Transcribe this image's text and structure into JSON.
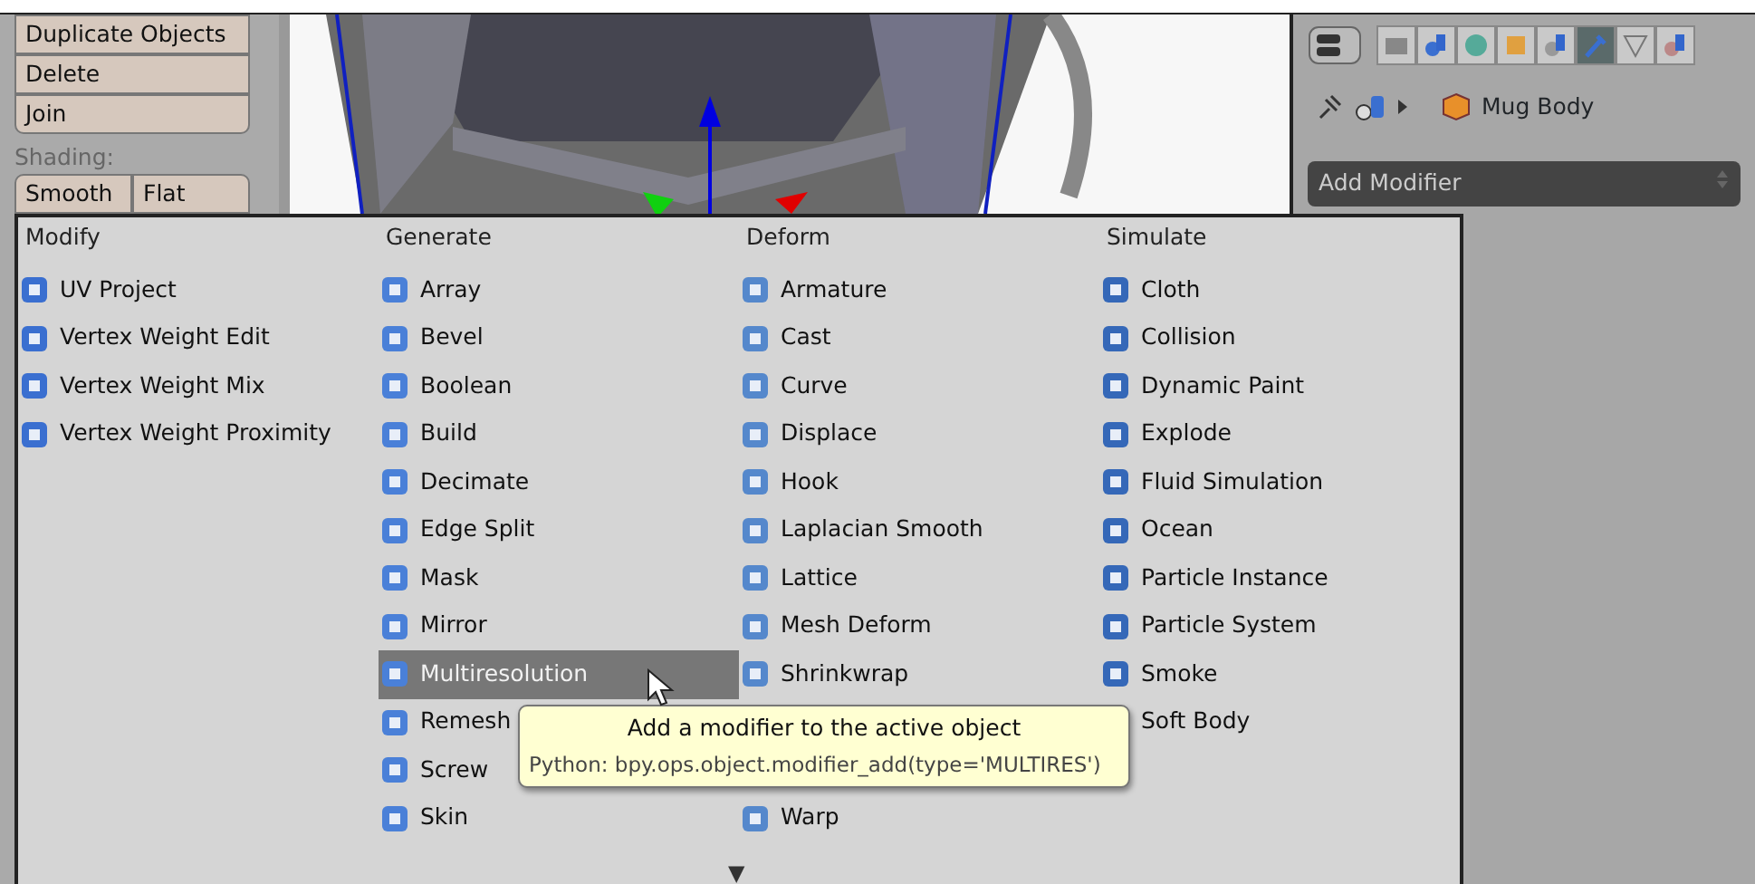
{
  "tool_panel": {
    "buttons": [
      "Duplicate Objects",
      "Delete",
      "Join"
    ],
    "shading_label": "Shading:",
    "shading_buttons": [
      "Smooth",
      "Flat"
    ]
  },
  "properties": {
    "tabs": [
      {
        "kind": "render",
        "selected": false
      },
      {
        "kind": "scene",
        "selected": false
      },
      {
        "kind": "world",
        "selected": false
      },
      {
        "kind": "object",
        "selected": false
      },
      {
        "kind": "constraints",
        "selected": false
      },
      {
        "kind": "modifiers",
        "selected": true
      },
      {
        "kind": "data",
        "selected": false
      },
      {
        "kind": "material",
        "selected": false
      }
    ],
    "object_name": "Mug Body",
    "add_modifier": "Add Modifier"
  },
  "menu": {
    "columns": [
      {
        "title": "Modify",
        "items": [
          {
            "label": "UV Project",
            "selected": false
          },
          {
            "label": "Vertex Weight Edit",
            "selected": false
          },
          {
            "label": "Vertex Weight Mix",
            "selected": false
          },
          {
            "label": "Vertex Weight Proximity",
            "selected": false
          }
        ]
      },
      {
        "title": "Generate",
        "items": [
          {
            "label": "Array",
            "selected": false
          },
          {
            "label": "Bevel",
            "selected": false
          },
          {
            "label": "Boolean",
            "selected": false
          },
          {
            "label": "Build",
            "selected": false
          },
          {
            "label": "Decimate",
            "selected": false
          },
          {
            "label": "Edge Split",
            "selected": false
          },
          {
            "label": "Mask",
            "selected": false
          },
          {
            "label": "Mirror",
            "selected": false
          },
          {
            "label": "Multiresolution",
            "selected": true
          },
          {
            "label": "Remesh",
            "selected": false
          },
          {
            "label": "Screw",
            "selected": false
          },
          {
            "label": "Skin",
            "selected": false
          }
        ]
      },
      {
        "title": "Deform",
        "items": [
          {
            "label": "Armature",
            "selected": false
          },
          {
            "label": "Cast",
            "selected": false
          },
          {
            "label": "Curve",
            "selected": false
          },
          {
            "label": "Displace",
            "selected": false
          },
          {
            "label": "Hook",
            "selected": false
          },
          {
            "label": "Laplacian Smooth",
            "selected": false
          },
          {
            "label": "Lattice",
            "selected": false
          },
          {
            "label": "Mesh Deform",
            "selected": false
          },
          {
            "label": "Shrinkwrap",
            "selected": false
          }
        ],
        "items_below_tooltip": [
          {
            "label": "Warp",
            "selected": false
          }
        ]
      },
      {
        "title": "Simulate",
        "items": [
          {
            "label": "Cloth",
            "selected": false
          },
          {
            "label": "Collision",
            "selected": false
          },
          {
            "label": "Dynamic Paint",
            "selected": false
          },
          {
            "label": "Explode",
            "selected": false
          },
          {
            "label": "Fluid Simulation",
            "selected": false
          },
          {
            "label": "Ocean",
            "selected": false
          },
          {
            "label": "Particle Instance",
            "selected": false
          },
          {
            "label": "Particle System",
            "selected": false
          },
          {
            "label": "Smoke",
            "selected": false
          },
          {
            "label": "Soft Body",
            "selected": false
          }
        ]
      }
    ],
    "more_arrow": "▼"
  },
  "tooltip": {
    "description": "Add a modifier to the active object",
    "python": "Python: bpy.ops.object.modifier_add(type='MULTIRES')"
  }
}
